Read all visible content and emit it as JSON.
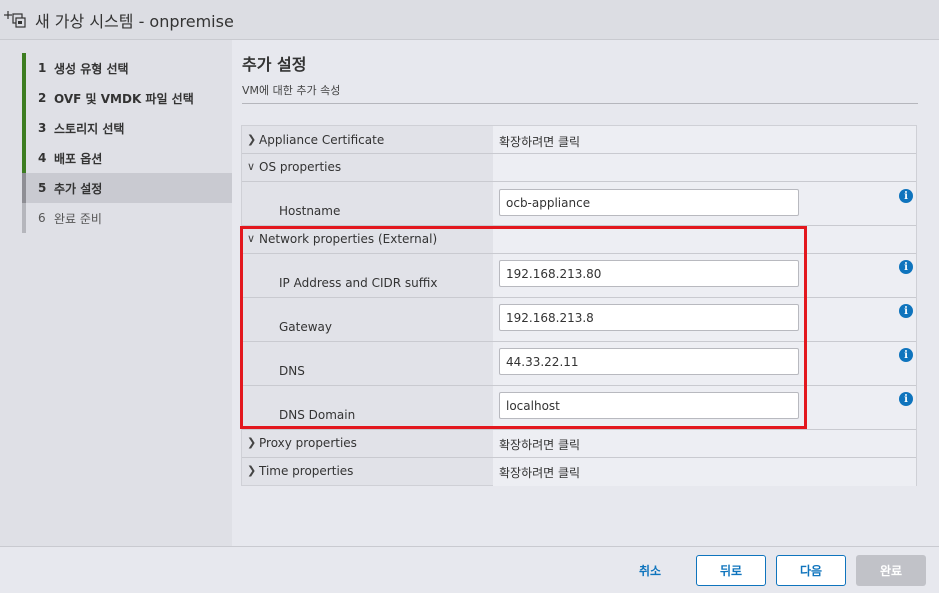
{
  "window": {
    "title": "새 가상 시스템 - onpremise"
  },
  "steps": [
    {
      "num": "1",
      "label": "생성 유형 선택"
    },
    {
      "num": "2",
      "label": "OVF 및 VMDK 파일 선택"
    },
    {
      "num": "3",
      "label": "스토리지 선택"
    },
    {
      "num": "4",
      "label": "배포 옵션"
    },
    {
      "num": "5",
      "label": "추가 설정"
    },
    {
      "num": "6",
      "label": "완료 준비"
    }
  ],
  "page": {
    "title": "추가 설정",
    "subtitle": "VM에 대한 추가 속성"
  },
  "properties": {
    "appliance_cert": {
      "label": "Appliance Certificate",
      "value": "확장하려면 클릭"
    },
    "os": {
      "label": "OS properties",
      "hostname_label": "Hostname",
      "hostname_value": "ocb-appliance"
    },
    "network": {
      "label": "Network properties (External)",
      "ip_label": "IP Address and CIDR suffix",
      "ip_value": "192.168.213.80",
      "gateway_label": "Gateway",
      "gateway_value": "192.168.213.8",
      "dns_label": "DNS",
      "dns_value": "44.33.22.11",
      "domain_label": "DNS Domain",
      "domain_value": "localhost"
    },
    "proxy": {
      "label": "Proxy properties",
      "value": "확장하려면 클릭"
    },
    "time": {
      "label": "Time properties",
      "value": "확장하려면 클릭"
    }
  },
  "footer": {
    "cancel": "취소",
    "back": "뒤로",
    "next": "다음",
    "finish": "완료"
  },
  "icons": {
    "window": "new-vm-icon",
    "info": "info-icon",
    "expanded": "chevron-down-icon",
    "collapsed": "chevron-right-icon"
  },
  "colors": {
    "accent": "#0f74bd",
    "done_step": "#3d7d20",
    "highlight": "#e3171e"
  }
}
